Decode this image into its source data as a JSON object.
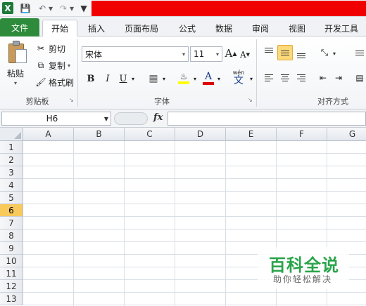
{
  "quick_access": {
    "app_icon": "excel-icon",
    "save_icon": "save-icon",
    "undo_icon": "undo-icon",
    "redo_icon": "redo-icon",
    "title_bar_color": "#f00000"
  },
  "tabs": [
    {
      "label": "文件"
    },
    {
      "label": "开始"
    },
    {
      "label": "插入"
    },
    {
      "label": "页面布局"
    },
    {
      "label": "公式"
    },
    {
      "label": "数据"
    },
    {
      "label": "审阅"
    },
    {
      "label": "视图"
    },
    {
      "label": "开发工具"
    }
  ],
  "active_tab": "开始",
  "ribbon": {
    "clipboard": {
      "paste": "粘贴",
      "cut": "剪切",
      "copy": "复制",
      "format_painter": "格式刷",
      "group_label": "剪贴板"
    },
    "font": {
      "font_name": "宋体",
      "font_size": "11",
      "grow": "A",
      "shrink": "A",
      "bold": "B",
      "italic": "I",
      "underline": "U",
      "font_color_letter": "A",
      "phonetic": "文",
      "phonetic_top": "wén",
      "group_label": "字体"
    },
    "alignment": {
      "group_label": "对齐方式"
    }
  },
  "formula_bar": {
    "name_box": "H6",
    "fx": "fx",
    "content": ""
  },
  "sheet": {
    "columns": [
      "A",
      "B",
      "C",
      "D",
      "E",
      "F",
      "G"
    ],
    "rows": [
      "1",
      "2",
      "3",
      "4",
      "5",
      "6",
      "7",
      "8",
      "9",
      "10",
      "11",
      "12",
      "13"
    ],
    "selected_row": "6"
  },
  "watermark": {
    "title": "百科全说",
    "subtitle": "助你轻松解决"
  }
}
